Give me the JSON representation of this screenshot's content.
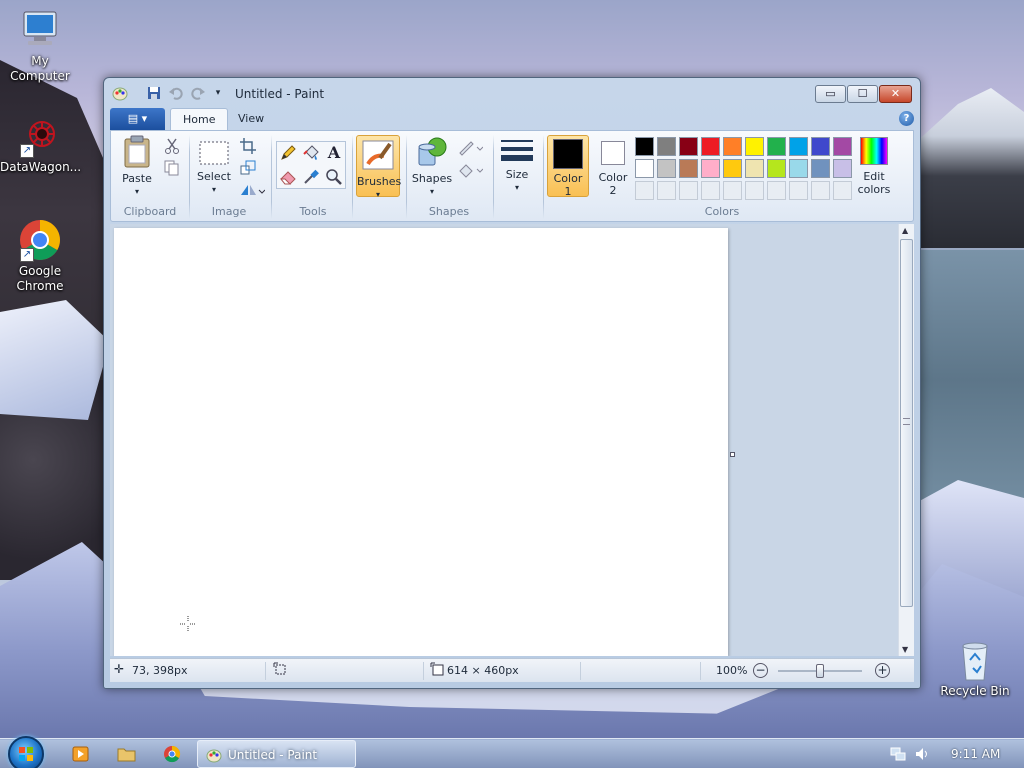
{
  "desktop": {
    "icons": [
      {
        "label": "My Computer"
      },
      {
        "label": "DataWagon..."
      },
      {
        "label": "Google Chrome"
      },
      {
        "label": "Recycle Bin"
      }
    ]
  },
  "window": {
    "title": "Untitled - Paint",
    "controls": {
      "minimize": "▭",
      "maximize": "☐",
      "close": "✕"
    }
  },
  "ribbon": {
    "tabs": {
      "file": "▤ ▾",
      "home": "Home",
      "view": "View"
    },
    "help": "?",
    "groups": {
      "clipboard": "Clipboard",
      "image": "Image",
      "tools": "Tools",
      "shapes": "Shapes",
      "colors": "Colors"
    },
    "buttons": {
      "paste": "Paste",
      "select": "Select",
      "brushes": "Brushes",
      "shapes": "Shapes",
      "size": "Size",
      "color1_line1": "Color",
      "color1_line2": "1",
      "color2_line1": "Color",
      "color2_line2": "2",
      "edit_colors_line1": "Edit",
      "edit_colors_line2": "colors"
    },
    "palette": {
      "row1": [
        "#000000",
        "#7f7f7f",
        "#880015",
        "#ed1c24",
        "#ff7f27",
        "#fff200",
        "#22b14c",
        "#00a2e8",
        "#3f48cc",
        "#a349a4"
      ],
      "row2": [
        "#ffffff",
        "#c3c3c3",
        "#b97a57",
        "#ffaec9",
        "#ffc90e",
        "#efe4b0",
        "#b5e61d",
        "#99d9ea",
        "#7092be",
        "#c8bfe7"
      ]
    },
    "color1": "#000000",
    "color2": "#ffffff"
  },
  "status": {
    "cursor_pos": "73, 398px",
    "canvas_size": "614 × 460px",
    "zoom": "100%"
  },
  "taskbar": {
    "task_label": "Untitled - Paint",
    "clock": "9:11 AM"
  }
}
